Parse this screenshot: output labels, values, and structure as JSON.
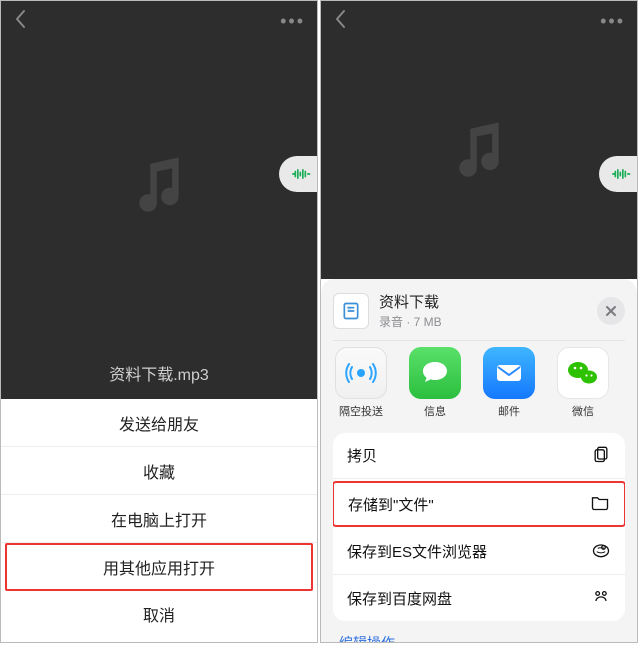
{
  "screen1": {
    "fileName": "资料下载.mp3",
    "sheet": {
      "items": [
        {
          "label": "发送给朋友",
          "highlight": false
        },
        {
          "label": "收藏",
          "highlight": false
        },
        {
          "label": "在电脑上打开",
          "highlight": false
        },
        {
          "label": "用其他应用打开",
          "highlight": true
        }
      ],
      "cancel": "取消"
    }
  },
  "screen2": {
    "file": {
      "title": "资料下载",
      "subline": "录音 · 7 MB"
    },
    "apps": [
      {
        "id": "airdrop",
        "label": "隔空投送"
      },
      {
        "id": "messages",
        "label": "信息"
      },
      {
        "id": "mail",
        "label": "邮件"
      },
      {
        "id": "wechat",
        "label": "微信"
      }
    ],
    "actions": [
      {
        "label": "拷贝",
        "icon": "copy",
        "highlight": false
      },
      {
        "label": "存储到\"文件\"",
        "icon": "folder",
        "highlight": true
      },
      {
        "label": "保存到ES文件浏览器",
        "icon": "es",
        "highlight": false
      },
      {
        "label": "保存到百度网盘",
        "icon": "baidu",
        "highlight": false
      }
    ],
    "edit": "编辑操作..."
  }
}
